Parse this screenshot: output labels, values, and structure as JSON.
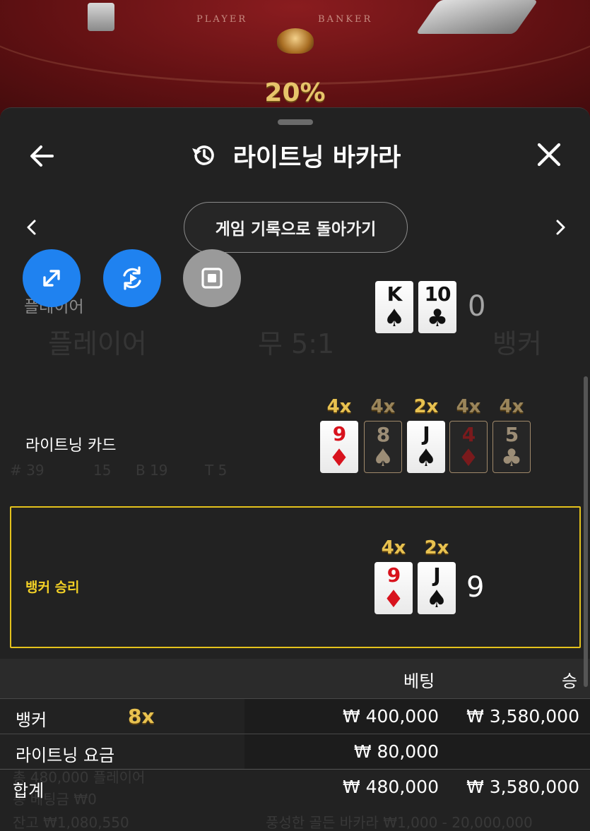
{
  "table": {
    "player_label": "PLAYER",
    "banker_label": "BANKER",
    "percent": "20%"
  },
  "header": {
    "title": "라이트닝 바카라",
    "back_to_history": "게임 기록으로 돌아가기"
  },
  "background_ghost": {
    "player": "플레이어",
    "tie": "무 5:1",
    "banker": "뱅커",
    "stats": [
      "# 39",
      "15",
      "B 19",
      "T 5"
    ],
    "footer_left": [
      "총 480,000 플레이어",
      "총 베팅금 ₩0",
      "잔고 ₩1,080,550"
    ],
    "footer_right": "풍성한 골든 바카라 ₩1,000 - 20,000,000"
  },
  "rows": {
    "player": {
      "label": "플레이어",
      "cards": [
        {
          "rank": "K",
          "suit": "♠",
          "color": "blk"
        },
        {
          "rank": "10",
          "suit": "♣",
          "color": "blk"
        }
      ],
      "score": "0"
    },
    "lightning": {
      "label": "라이트닝 카드",
      "cards": [
        {
          "rank": "9",
          "suit": "♦",
          "color": "red",
          "mult": "4x",
          "active": true
        },
        {
          "rank": "8",
          "suit": "♠",
          "color": "blk",
          "mult": "4x",
          "active": false
        },
        {
          "rank": "J",
          "suit": "♠",
          "color": "blk",
          "mult": "2x",
          "active": true
        },
        {
          "rank": "4",
          "suit": "♦",
          "color": "red",
          "mult": "4x",
          "active": false
        },
        {
          "rank": "5",
          "suit": "♣",
          "color": "blk",
          "mult": "4x",
          "active": false
        }
      ]
    },
    "banker": {
      "label": "뱅커 승리",
      "cards": [
        {
          "rank": "9",
          "suit": "♦",
          "color": "red",
          "mult": "4x"
        },
        {
          "rank": "J",
          "suit": "♠",
          "color": "blk",
          "mult": "2x"
        }
      ],
      "score": "9"
    }
  },
  "bet_table": {
    "col_bet": "베팅",
    "col_win": "승",
    "rows": [
      {
        "label": "뱅커",
        "multiplier": "8x",
        "bet": "₩ 400,000",
        "win": "₩ 3,580,000"
      },
      {
        "label": "라이트닝 요금",
        "bet": "₩ 80,000",
        "win": ""
      },
      {
        "label": "합계",
        "bet": "₩ 480,000",
        "win": "₩ 3,580,000"
      }
    ]
  },
  "icons": {
    "back": "arrow-left-icon",
    "history": "history-icon",
    "close": "close-icon",
    "prev": "chevron-left-icon",
    "next": "chevron-right-icon",
    "expand": "expand-icon",
    "replay": "replay-icon",
    "stop": "stop-icon"
  },
  "colors": {
    "accent_gold": "#e8c250",
    "win_border": "#e4c21c",
    "fab_blue": "#1f82f0",
    "red_suit": "#d8121d"
  }
}
